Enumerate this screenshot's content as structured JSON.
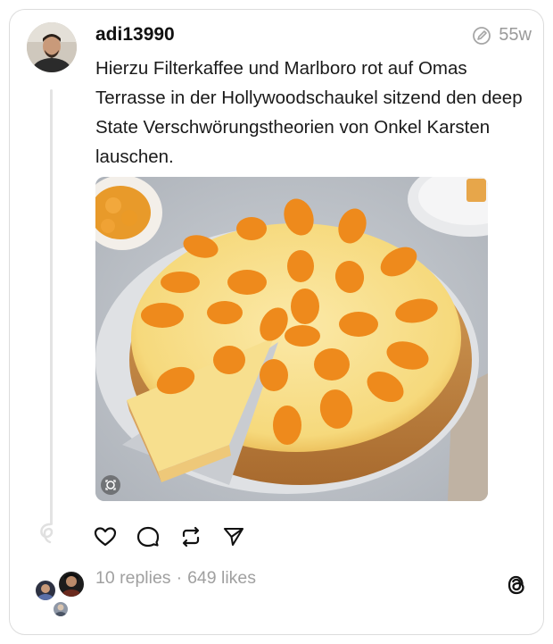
{
  "post": {
    "username": "adi13990",
    "time": "55w",
    "text": "Hierzu Filterkaffee und Marlboro rot auf Omas Terrasse in der Hollywoodschaukel sitzend den deep State Verschwörungstheorien von Onkel Karsten lauschen."
  },
  "stats": {
    "replies": "10 replies",
    "separator": "·",
    "likes": "649 likes"
  },
  "icons": {
    "edited": "pencil-circle-icon",
    "like": "heart-icon",
    "comment": "speech-bubble-icon",
    "repost": "repost-icon",
    "share": "send-icon",
    "brand": "threads-logo-icon"
  },
  "colors": {
    "border": "#dcdcdc",
    "muted": "#9a9a9a",
    "text": "#101010"
  }
}
